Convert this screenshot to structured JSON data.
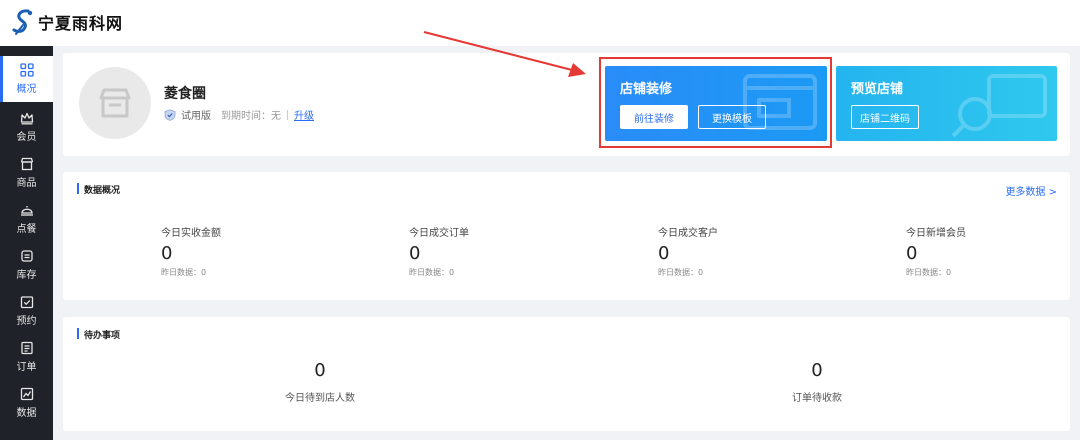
{
  "brand": {
    "name": "宁夏雨科网"
  },
  "sidebar": {
    "items": [
      {
        "label": "概况",
        "icon": "grid-icon",
        "active": true
      },
      {
        "label": "会员",
        "icon": "crown-icon"
      },
      {
        "label": "商品",
        "icon": "store-icon"
      },
      {
        "label": "点餐",
        "icon": "dish-icon"
      },
      {
        "label": "库存",
        "icon": "warehouse-icon"
      },
      {
        "label": "预约",
        "icon": "calendar-check-icon"
      },
      {
        "label": "订单",
        "icon": "order-icon"
      },
      {
        "label": "数据",
        "icon": "chart-icon"
      }
    ]
  },
  "profile": {
    "shop_name": "菱食圈",
    "edition": "试用版",
    "expiry": "到期时间：无",
    "upgrade": "升级"
  },
  "promos": {
    "decorate": {
      "title": "店铺装修",
      "primary_btn": "前往装修",
      "secondary_btn": "更换模板"
    },
    "preview": {
      "title": "预览店铺",
      "btn": "店铺二维码"
    }
  },
  "overview": {
    "title": "数据概况",
    "more": "更多数据 >",
    "stats": [
      {
        "label": "今日实收金额",
        "value": "0",
        "sub": "昨日数据：0"
      },
      {
        "label": "今日成交订单",
        "value": "0",
        "sub": "昨日数据：0"
      },
      {
        "label": "今日成交客户",
        "value": "0",
        "sub": "昨日数据：0"
      },
      {
        "label": "今日新增会员",
        "value": "0",
        "sub": "昨日数据：0"
      }
    ]
  },
  "todo": {
    "title": "待办事项",
    "items": [
      {
        "value": "0",
        "label": "今日待到店人数"
      },
      {
        "value": "0",
        "label": "订单待收款"
      }
    ]
  },
  "colors": {
    "accent": "#2b6cf6",
    "highlight": "#e53935",
    "sidebar_bg": "#1f2329"
  }
}
